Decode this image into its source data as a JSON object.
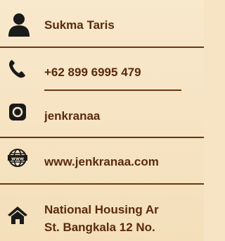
{
  "contact": {
    "name": "Sukma Taris",
    "phone": "+62 899 6995 479",
    "instagram": "jenkranaa",
    "website": "www.jenkranaa.com",
    "address_line1": "National Housing Ar",
    "address_line2": "St. Bangkala 12 No."
  },
  "icons": {
    "person": "person-icon",
    "phone": "phone-icon",
    "instagram": "instagram-icon",
    "web": "globe-www-icon",
    "home": "home-icon"
  },
  "colors": {
    "background": "#f6e4c4",
    "text": "#5a2a0c",
    "icon": "#1a1a1a",
    "divider": "#6b3712"
  }
}
